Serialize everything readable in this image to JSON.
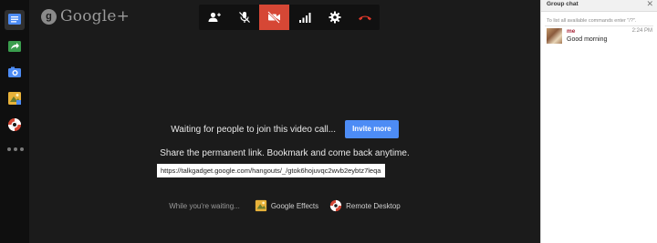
{
  "brand": {
    "logo_glyph": "g",
    "logo_text": "Google+"
  },
  "rail": {
    "items": [
      {
        "name": "chat-icon",
        "color": "#4d8cf5"
      },
      {
        "name": "share-screen-icon",
        "color": "#3a9d4d"
      },
      {
        "name": "camera-icon",
        "color": "#4d8cf5"
      },
      {
        "name": "effects-icon",
        "color": "#e8b23a"
      },
      {
        "name": "remote-desktop-icon",
        "color": "#d64735"
      }
    ]
  },
  "toolbar": {
    "buttons": [
      "invite-people-icon",
      "mute-mic-icon",
      "camera-off-icon",
      "bandwidth-icon",
      "settings-icon",
      "hang-up-icon"
    ],
    "accent": "#d64735"
  },
  "main": {
    "waiting_text": "Waiting for people to join this video call...",
    "invite_label": "Invite more",
    "share_text": "Share the permanent link. Bookmark and come back anytime.",
    "link": "https://talkgadget.google.com/hangouts/_/gtok6hojuvqc2wvb2eybtz7leqa",
    "while_waiting": "While you're waiting...",
    "effects_label": "Google Effects",
    "remote_label": "Remote Desktop"
  },
  "chat": {
    "title": "Group chat",
    "close": "✕",
    "hint": "To list all available commands enter \"/?\".",
    "messages": [
      {
        "sender": "me",
        "time": "2:24 PM",
        "text": "Good morning"
      }
    ]
  }
}
